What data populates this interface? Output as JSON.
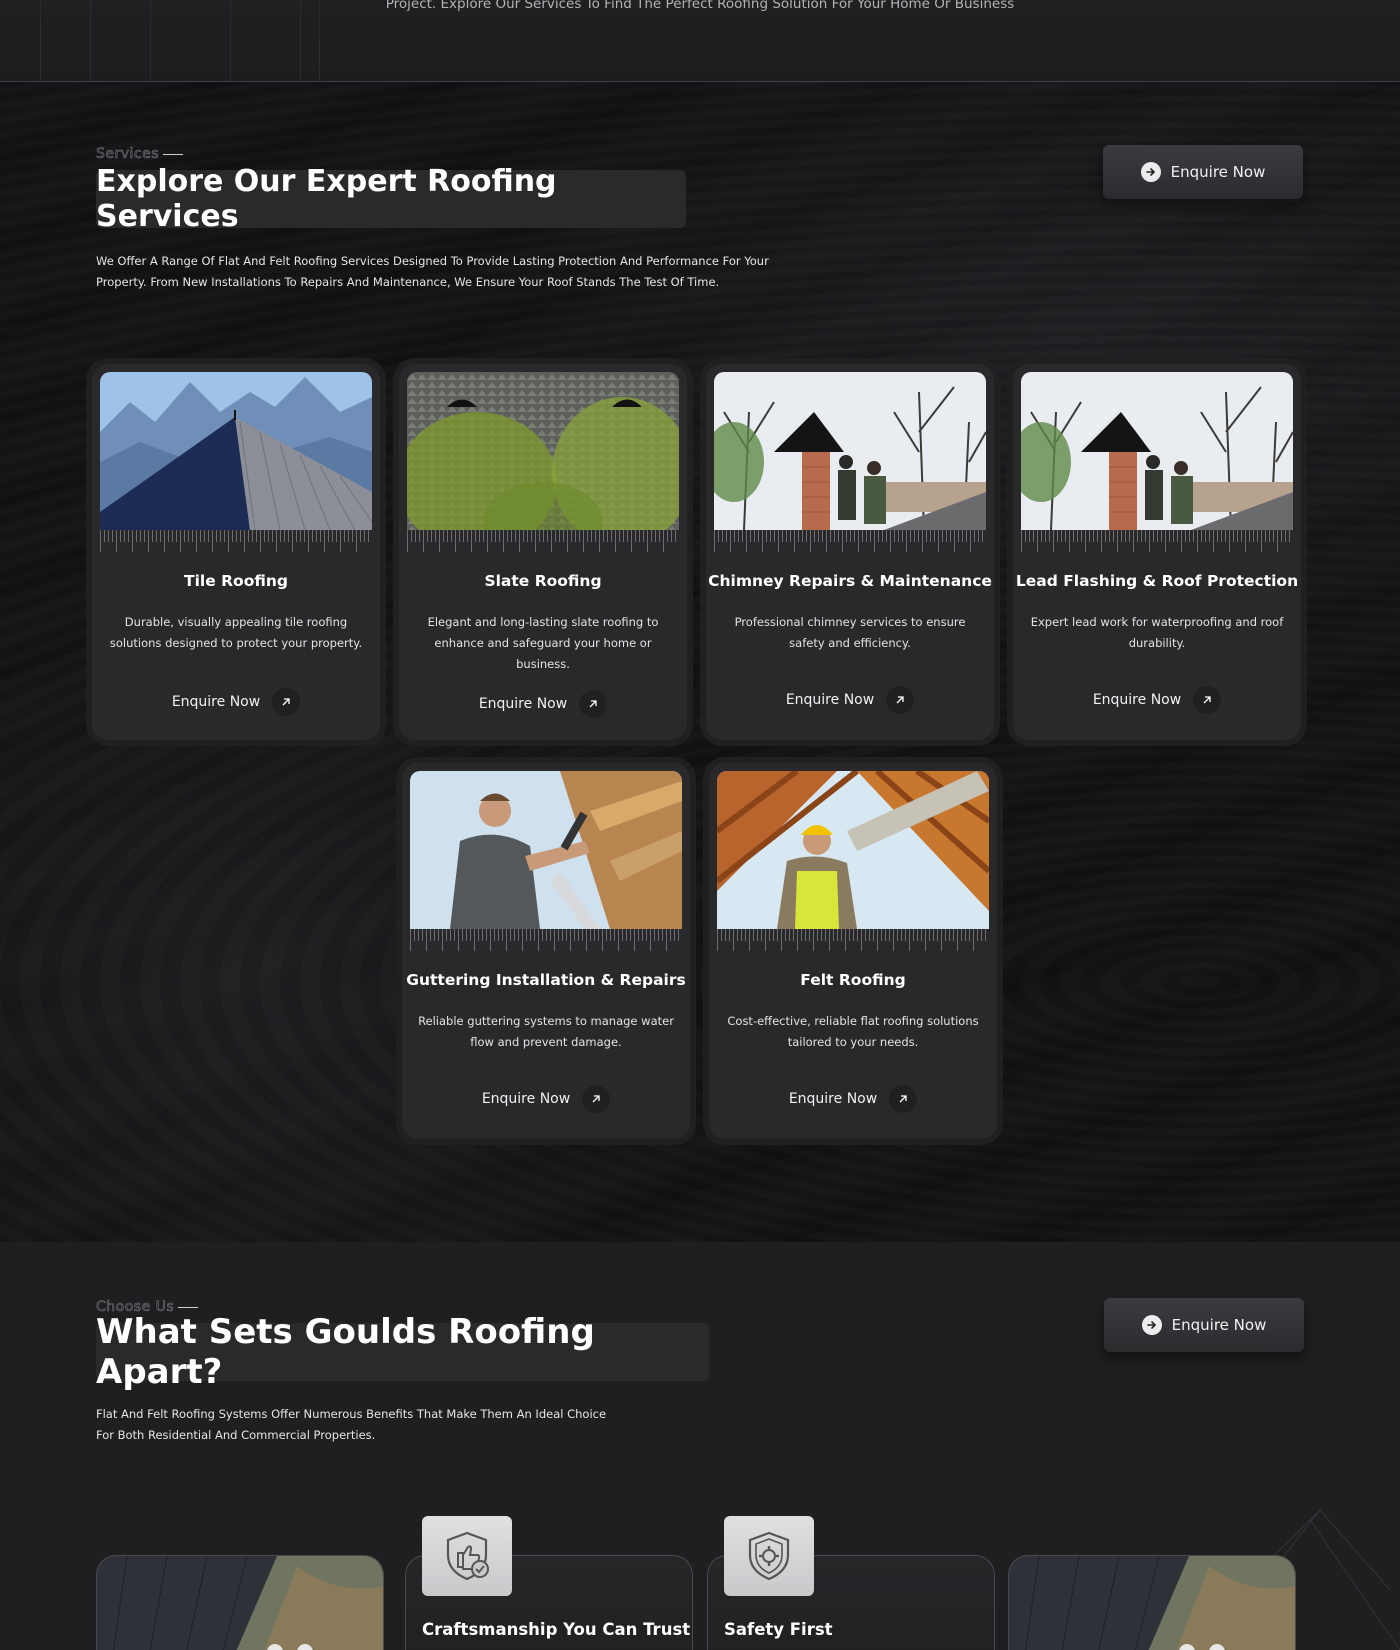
{
  "top": {
    "tagline": "Project. Explore Our Services To Find The Perfect Roofing Solution For Your Home Or Business"
  },
  "services": {
    "eyebrow": "Services",
    "title": "Explore Our Expert Roofing Services",
    "intro_line1": "We Offer A Range Of Flat And Felt Roofing Services Designed To Provide Lasting Protection And Performance For Your",
    "intro_line2": "Property. From New Installations To Repairs And Maintenance, We Ensure Your Roof Stands The Test Of Time.",
    "enquire_label": "Enquire Now",
    "cards": [
      {
        "title": "Tile Roofing",
        "desc": "Durable, visually appealing tile roofing solutions designed to protect your property.",
        "cta": "Enquire Now",
        "image": "tile-roof-mountains"
      },
      {
        "title": "Slate Roofing",
        "desc": "Elegant and long-lasting slate roofing to enhance and safeguard your home or business.",
        "cta": "Enquire Now",
        "image": "mossy-slate-roof"
      },
      {
        "title": "Chimney Repairs & Maintenance",
        "desc": "Professional chimney services to ensure safety and efficiency.",
        "cta": "Enquire Now",
        "image": "chimney-workers"
      },
      {
        "title": "Lead Flashing & Roof Protection",
        "desc": "Expert lead work for waterproofing and roof durability.",
        "cta": "Enquire Now",
        "image": "chimney-workers"
      },
      {
        "title": "Guttering Installation & Repairs",
        "desc": "Reliable guttering systems to manage water flow and prevent damage.",
        "cta": "Enquire Now",
        "image": "worker-hammer"
      },
      {
        "title": "Felt Roofing",
        "desc": "Cost-effective, reliable flat roofing solutions tailored to your needs.",
        "cta": "Enquire Now",
        "image": "worker-rafters"
      }
    ]
  },
  "why": {
    "eyebrow": "Choose Us",
    "title": "What Sets Goulds Roofing Apart?",
    "intro_line1": "Flat And Felt Roofing Systems Offer Numerous Benefits That Make Them An Ideal Choice",
    "intro_line2": "For Both Residential And Commercial Properties.",
    "enquire_label": "Enquire Now",
    "features": [
      {
        "title": "Craftsmanship You Can Trust",
        "icon": "thumbs-up-shield-icon"
      },
      {
        "title": "Safety First",
        "icon": "gear-shield-icon"
      }
    ]
  },
  "colors": {
    "background": "#1f1f21",
    "card": "#29292c",
    "text": "#ffffff",
    "divider": "#3a4250"
  }
}
